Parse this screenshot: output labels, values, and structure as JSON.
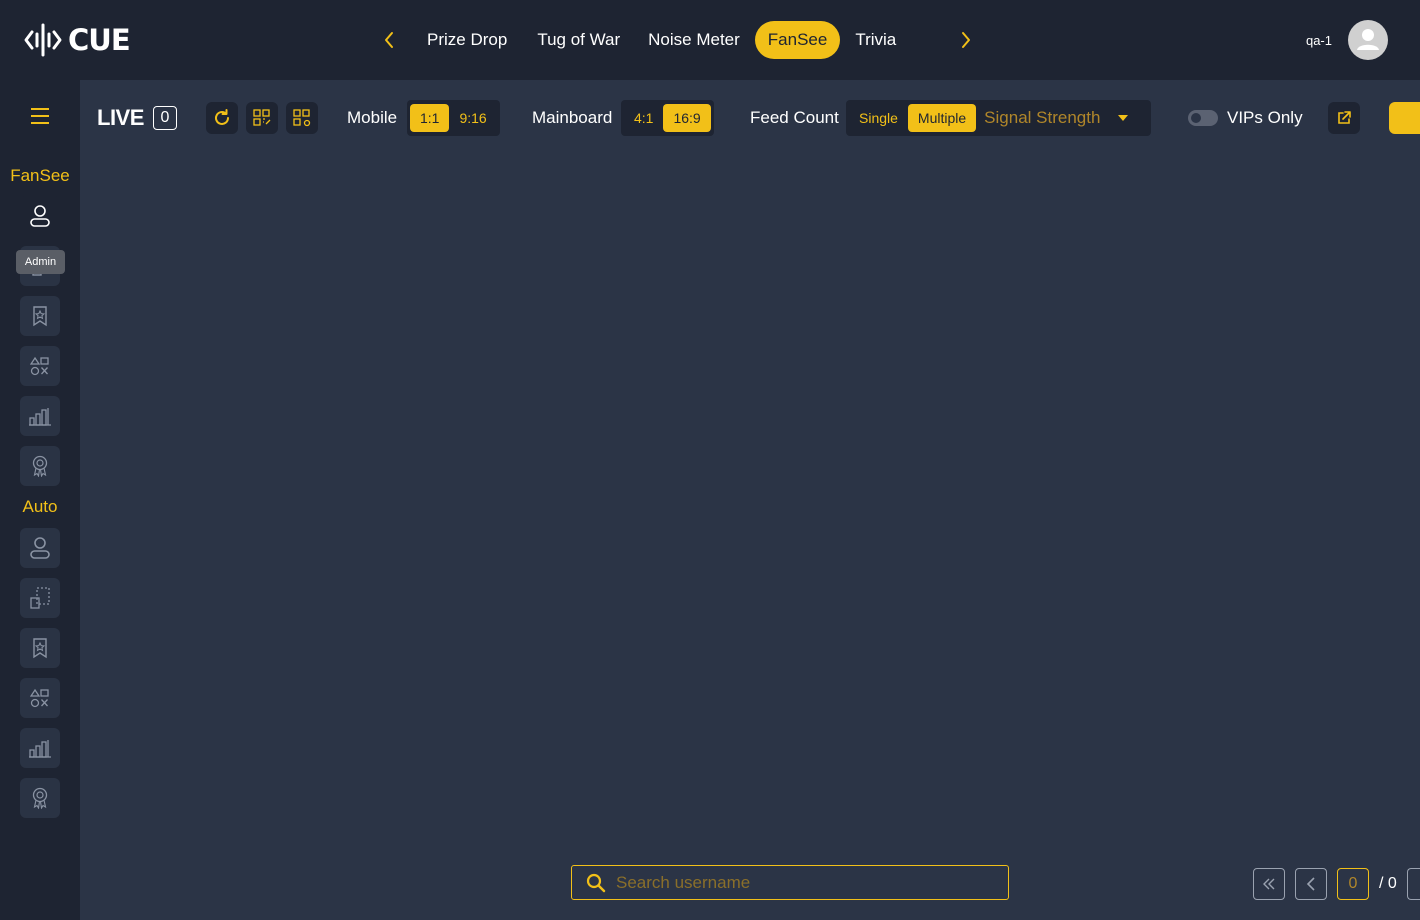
{
  "app": {
    "logo_text": "CUE"
  },
  "nav": {
    "items": [
      {
        "label": "Prize Drop",
        "active": false
      },
      {
        "label": "Tug of War",
        "active": false
      },
      {
        "label": "Noise Meter",
        "active": false
      },
      {
        "label": "FanSee",
        "active": true
      },
      {
        "label": "Trivia",
        "active": false
      }
    ]
  },
  "user": {
    "name": "qa-1"
  },
  "sidebar": {
    "section1_label": "FanSee",
    "section2_label": "Auto",
    "tooltip": "Admin",
    "section1_icons": [
      "user-icon",
      "layout-icon",
      "star-bookmark-icon",
      "shapes-icon",
      "bar-chart-icon",
      "award-icon"
    ],
    "section2_icons": [
      "user-icon",
      "layout-icon",
      "star-bookmark-icon",
      "shapes-icon",
      "bar-chart-icon",
      "award-icon"
    ]
  },
  "toolbar": {
    "live_label": "LIVE",
    "live_count": "0",
    "mobile_label": "Mobile",
    "mobile_options": [
      "1:1",
      "9:16"
    ],
    "mobile_selected": "1:1",
    "mainboard_label": "Mainboard",
    "mainboard_options": [
      "4:1",
      "16:9"
    ],
    "mainboard_selected": "16:9",
    "feed_count_label": "Feed Count",
    "feed_options": [
      "Single",
      "Multiple"
    ],
    "feed_selected": "Multiple",
    "sort_select_value": "Signal Strength",
    "vips_label": "VIPs Only",
    "vips_on": false
  },
  "search": {
    "placeholder": "Search username",
    "value": ""
  },
  "pager": {
    "current": "0",
    "total_label": "/ 0"
  },
  "colors": {
    "accent": "#f2c018",
    "bg_dark": "#1e2432",
    "bg_main": "#2b3446"
  }
}
